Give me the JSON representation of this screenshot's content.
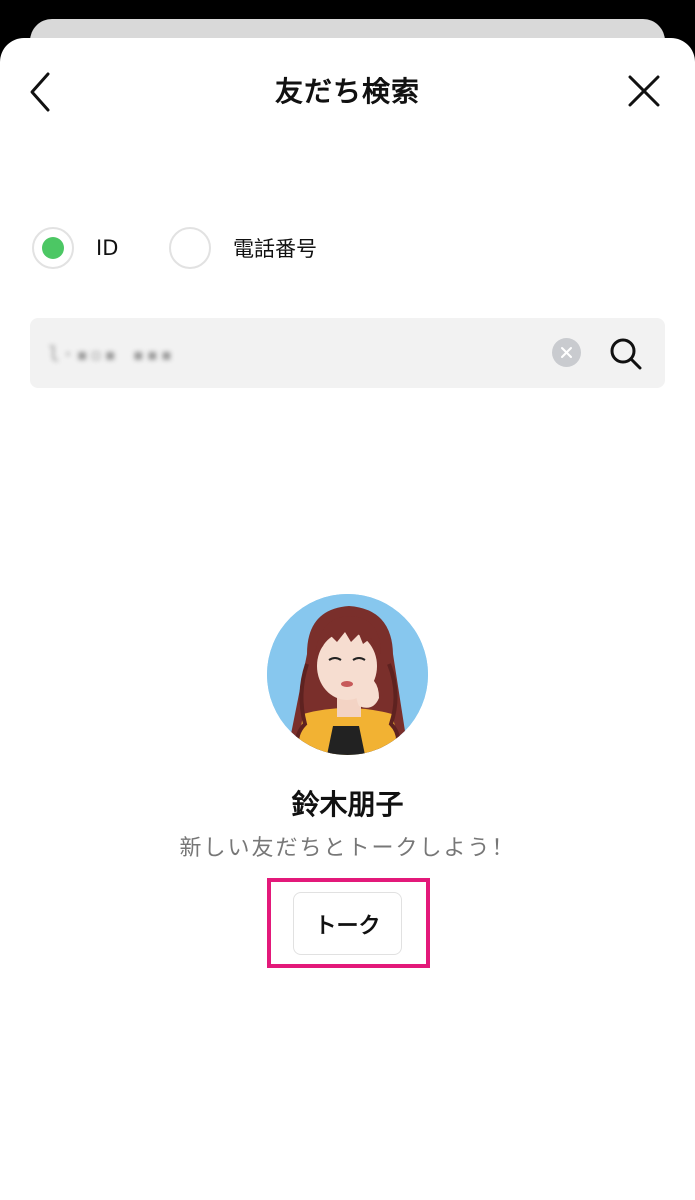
{
  "header": {
    "title": "友だち検索",
    "back_icon": "chevron-left-icon",
    "close_icon": "close-icon"
  },
  "search_type": {
    "options": [
      {
        "label": "ID",
        "selected": true
      },
      {
        "label": "電話番号",
        "selected": false
      }
    ],
    "selected_color": "#4cc764"
  },
  "search": {
    "value": "l·▪▫▪ ▪▪▪",
    "clear_icon": "clear-icon",
    "search_icon": "search-icon"
  },
  "result": {
    "name": "鈴木朋子",
    "subtitle": "新しい友だちとトークしよう！",
    "talk_button_label": "トーク",
    "highlight_color": "#e3197a"
  }
}
